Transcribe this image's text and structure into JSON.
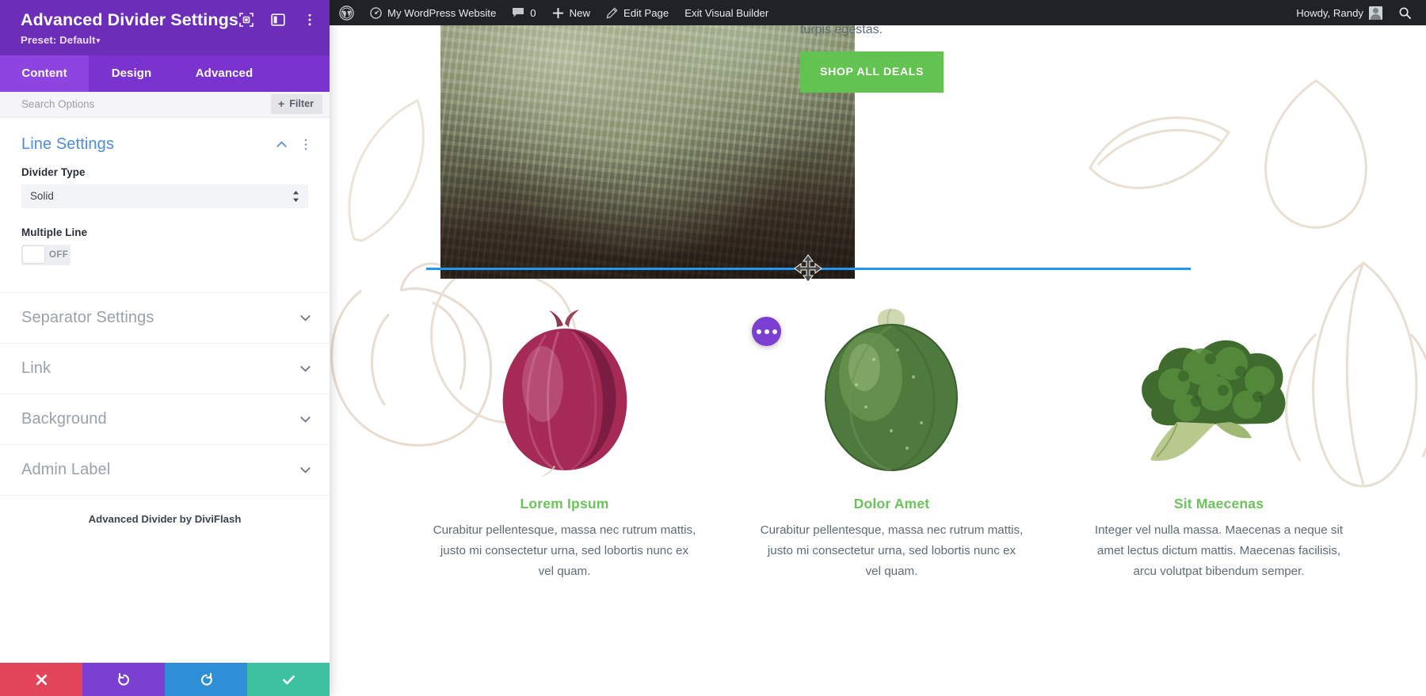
{
  "settings_panel": {
    "title": "Advanced Divider Settings",
    "preset_label": "Preset: Default",
    "header_icons": [
      {
        "name": "focus-icon"
      },
      {
        "name": "layout-panel-icon"
      },
      {
        "name": "more-vertical-icon"
      }
    ],
    "tabs": [
      {
        "label": "Content",
        "active": true
      },
      {
        "label": "Design",
        "active": false
      },
      {
        "label": "Advanced",
        "active": false
      }
    ],
    "search": {
      "placeholder": "Search Options",
      "value": ""
    },
    "filter_button": {
      "label": "Filter",
      "plus": "+"
    },
    "open_section": {
      "title": "Line Settings",
      "fields": {
        "divider_type": {
          "label": "Divider Type",
          "value": "Solid"
        },
        "multiple_line": {
          "label": "Multiple Line",
          "state": "OFF"
        }
      }
    },
    "collapsed_sections": [
      {
        "label": "Separator Settings"
      },
      {
        "label": "Link"
      },
      {
        "label": "Background"
      },
      {
        "label": "Admin Label"
      }
    ],
    "footnote": "Advanced Divider by DiviFlash",
    "actions": [
      {
        "name": "cancel",
        "icon": "close-icon",
        "color": "#e2455a"
      },
      {
        "name": "undo",
        "icon": "undo-icon",
        "color": "#7b3fd1"
      },
      {
        "name": "redo",
        "icon": "redo-icon",
        "color": "#2e8ed6"
      },
      {
        "name": "save",
        "icon": "check-icon",
        "color": "#3ec1a0"
      }
    ]
  },
  "admin_bar": {
    "wp_logo": "wordpress-logo-icon",
    "site_name": "My WordPress Website",
    "comments_count": "0",
    "new_label": "New",
    "edit_page_label": "Edit Page",
    "exit_builder_label": "Exit Visual Builder",
    "howdy": "Howdy, Randy",
    "search_icon": "search-icon"
  },
  "page": {
    "cut_paragraph": "turpis egestas.",
    "shop_button": "SHOP ALL DEALS",
    "divider_color": "#2196f3",
    "columns": [
      {
        "title": "Lorem Ipsum",
        "text": "Curabitur pellentesque, massa nec rutrum mattis, justo mi consectetur urna, sed lobortis nunc ex vel quam.",
        "image": "red-onion"
      },
      {
        "title": "Dolor Amet",
        "text": "Curabitur pellentesque, massa nec rutrum mattis, justo mi consectetur urna, sed lobortis nunc ex vel quam.",
        "image": "round-zucchini"
      },
      {
        "title": "Sit Maecenas",
        "text": "Integer vel nulla massa. Maecenas a neque sit amet lectus dictum mattis. Maecenas facilisis, arcu volutpat bibendum semper.",
        "image": "broccoli"
      }
    ],
    "fab": {
      "name": "module-options-fab",
      "icon": "ellipsis-icon"
    }
  }
}
